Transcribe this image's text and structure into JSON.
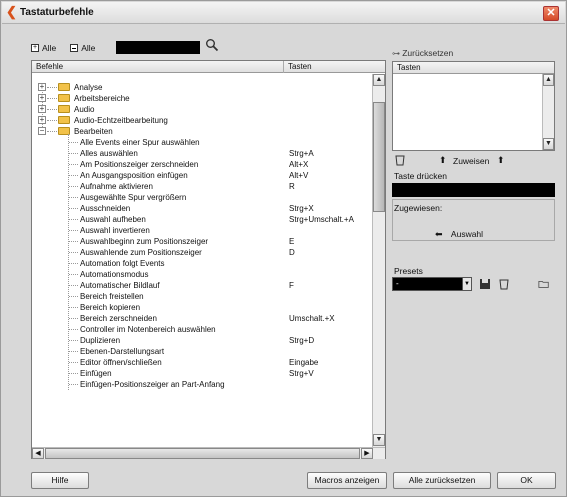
{
  "window": {
    "title": "Tastaturbefehle",
    "close_label": "✕",
    "app_icon_glyph": "❮"
  },
  "filter": {
    "expand_all_label": "Alle",
    "collapse_all_label": "Alle"
  },
  "list": {
    "columns": {
      "commands": "Befehle",
      "keys": "Tasten"
    },
    "folders": [
      {
        "label": "Analyse"
      },
      {
        "label": "Arbeitsbereiche"
      },
      {
        "label": "Audio"
      },
      {
        "label": "Audio-Echtzeitbearbeitung"
      },
      {
        "label": "Bearbeiten"
      }
    ],
    "commands": [
      {
        "label": "Alle Events einer Spur auswählen",
        "key": ""
      },
      {
        "label": "Alles auswählen",
        "key": "Strg+A"
      },
      {
        "label": "Am Positionszeiger zerschneiden",
        "key": "Alt+X"
      },
      {
        "label": "An Ausgangsposition einfügen",
        "key": "Alt+V"
      },
      {
        "label": "Aufnahme aktivieren",
        "key": "R"
      },
      {
        "label": "Ausgewählte Spur vergrößern",
        "key": ""
      },
      {
        "label": "Ausschneiden",
        "key": "Strg+X"
      },
      {
        "label": "Auswahl aufheben",
        "key": "Strg+Umschalt.+A"
      },
      {
        "label": "Auswahl invertieren",
        "key": ""
      },
      {
        "label": "Auswahlbeginn zum Positionszeiger",
        "key": "E"
      },
      {
        "label": "Auswahlende zum Positionszeiger",
        "key": "D"
      },
      {
        "label": "Automation folgt Events",
        "key": ""
      },
      {
        "label": "Automationsmodus",
        "key": ""
      },
      {
        "label": "Automatischer Bildlauf",
        "key": "F"
      },
      {
        "label": "Bereich freistellen",
        "key": ""
      },
      {
        "label": "Bereich kopieren",
        "key": ""
      },
      {
        "label": "Bereich zerschneiden",
        "key": "Umschalt.+X"
      },
      {
        "label": "Controller im Notenbereich auswählen",
        "key": ""
      },
      {
        "label": "Duplizieren",
        "key": "Strg+D"
      },
      {
        "label": "Ebenen-Darstellungsart",
        "key": ""
      },
      {
        "label": "Editor öffnen/schließen",
        "key": "Eingabe"
      },
      {
        "label": "Einfügen",
        "key": "Strg+V"
      },
      {
        "label": "Einfügen-Positionszeiger an Part-Anfang",
        "key": ""
      }
    ]
  },
  "right": {
    "reset_label": "Zurücksetzen",
    "keys_header": "Tasten",
    "assign_label": "Zuweisen",
    "press_key_label": "Taste drücken",
    "assigned_label": "Zugewiesen:",
    "select_label": "Auswahl",
    "presets_label": "Presets",
    "presets_value": "-"
  },
  "buttons": {
    "help": "Hilfe",
    "show_macros": "Macros anzeigen",
    "reset_all": "Alle zurücksetzen",
    "ok": "OK"
  },
  "colors": {
    "folder": "#f2c24a",
    "close": "#d44a28",
    "field_black": "#000000"
  }
}
